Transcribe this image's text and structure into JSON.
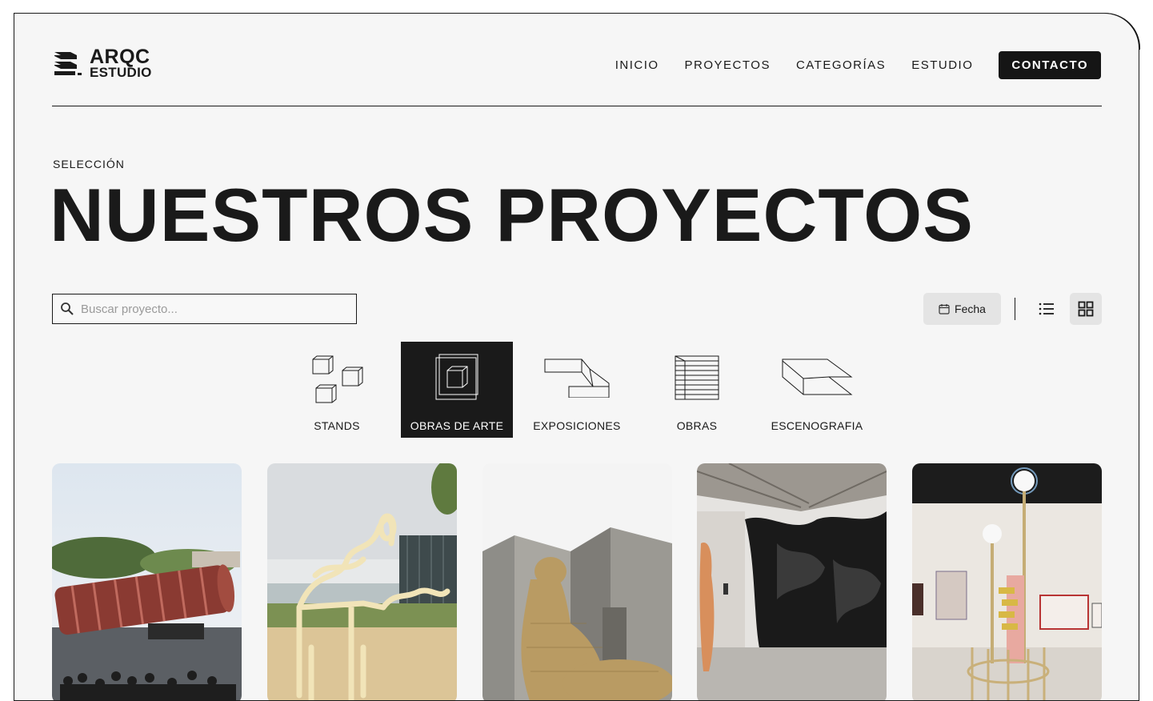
{
  "brand": {
    "line1": "ARQC",
    "line2": "ESTUDIO"
  },
  "nav": {
    "items": [
      "INICIO",
      "PROYECTOS",
      "CATEGORÍAS",
      "ESTUDIO"
    ],
    "contact": "CONTACTO"
  },
  "hero": {
    "eyebrow": "SELECCIÓN",
    "title": "NUESTROS PROYECTOS"
  },
  "search": {
    "placeholder": "Buscar proyecto...",
    "value": ""
  },
  "sort": {
    "label": "Fecha"
  },
  "view": {
    "active": "grid"
  },
  "categories": [
    {
      "label": "STANDS",
      "icon": "cubes-icon",
      "active": false
    },
    {
      "label": "OBRAS DE ARTE",
      "icon": "framed-cube-icon",
      "active": true
    },
    {
      "label": "EXPOSICIONES",
      "icon": "step-panel-icon",
      "active": false
    },
    {
      "label": "OBRAS",
      "icon": "stacked-slabs-icon",
      "active": false
    },
    {
      "label": "ESCENOGRAFIA",
      "icon": "stage-platform-icon",
      "active": false
    }
  ],
  "projects": [
    {
      "image": "red-cylinder-sculpture"
    },
    {
      "image": "yellow-chair-sculpture"
    },
    {
      "image": "woven-figure-concrete-building"
    },
    {
      "image": "dark-rock-installation-gallery"
    },
    {
      "image": "lamp-post-gallery-installation"
    }
  ],
  "colors": {
    "background": "#f6f6f6",
    "ink": "#1a1a1a",
    "active_bg": "#1a1a1a",
    "chip_bg": "#e4e4e4"
  }
}
